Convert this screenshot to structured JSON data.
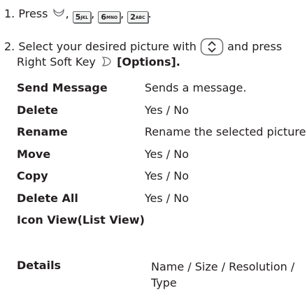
{
  "step1": {
    "text": "1. Press",
    "comma1": ",",
    "comma2": ",",
    "comma3": ",",
    "end": ".",
    "keys": [
      {
        "digit": "5",
        "letters": "JKL"
      },
      {
        "digit": "6",
        "letters": "MNO"
      },
      {
        "digit": "2",
        "letters": "ABC"
      }
    ],
    "icon": "menu-softkey-icon"
  },
  "step2": {
    "text_a": "2. Select your desired picture with",
    "text_b": "and press",
    "text_c": "Right Soft Key",
    "options_label": "[Options].",
    "nav_icon": "navigation-key-icon",
    "softkey_icon": "right-softkey-icon"
  },
  "options": [
    {
      "name": "Send Message",
      "desc": "Sends a message."
    },
    {
      "name": "Delete",
      "desc": "Yes / No"
    },
    {
      "name": "Rename",
      "desc": "Rename the selected picture."
    },
    {
      "name": "Move",
      "desc": "Yes / No"
    },
    {
      "name": "Copy",
      "desc": "Yes / No"
    },
    {
      "name": "Delete All",
      "desc": "Yes / No"
    },
    {
      "name": "Icon View(List View)",
      "desc": ""
    }
  ],
  "details": {
    "name": "Details",
    "desc_line1": "Name / Size / Resolution /",
    "desc_line2": "Type"
  },
  "colors": {
    "text": "#231f20",
    "key_border": "#6d6e71"
  }
}
